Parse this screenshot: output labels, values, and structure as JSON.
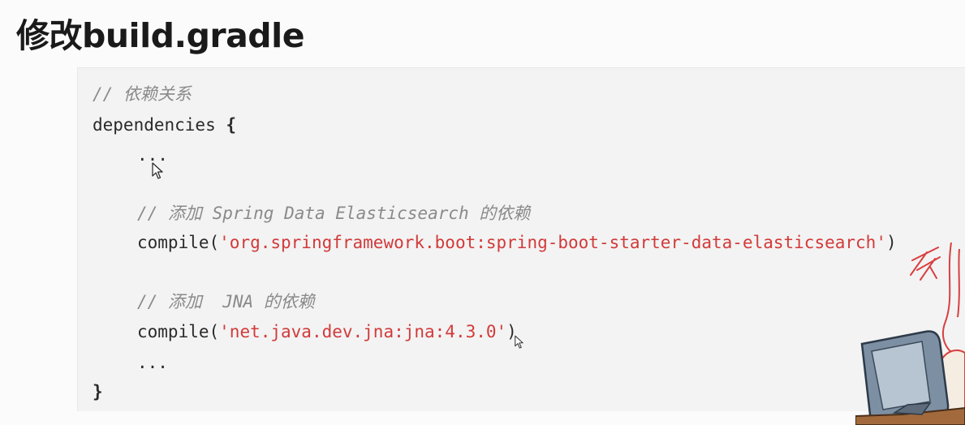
{
  "slide": {
    "title": "修改build.gradle"
  },
  "code": {
    "comment_dependencies": "// 依赖关系",
    "dependencies_keyword": "dependencies",
    "open_brace": "{",
    "ellipsis_top": "...",
    "comment_spring": "// 添加 Spring Data Elasticsearch 的依赖",
    "compile_fn": "compile(",
    "spring_artifact": "'org.springframework.boot:spring-boot-starter-data-elasticsearch'",
    "close_paren": ")",
    "comment_jna": "// 添加  JNA 的依赖",
    "jna_artifact": "'net.java.dev.jna:jna:4.3.0'",
    "ellipsis_bottom": "...",
    "close_brace": "}"
  },
  "icons": {
    "cursor": "mouse-pointer-icon",
    "decoration": "cartoon-computer-illustration"
  }
}
